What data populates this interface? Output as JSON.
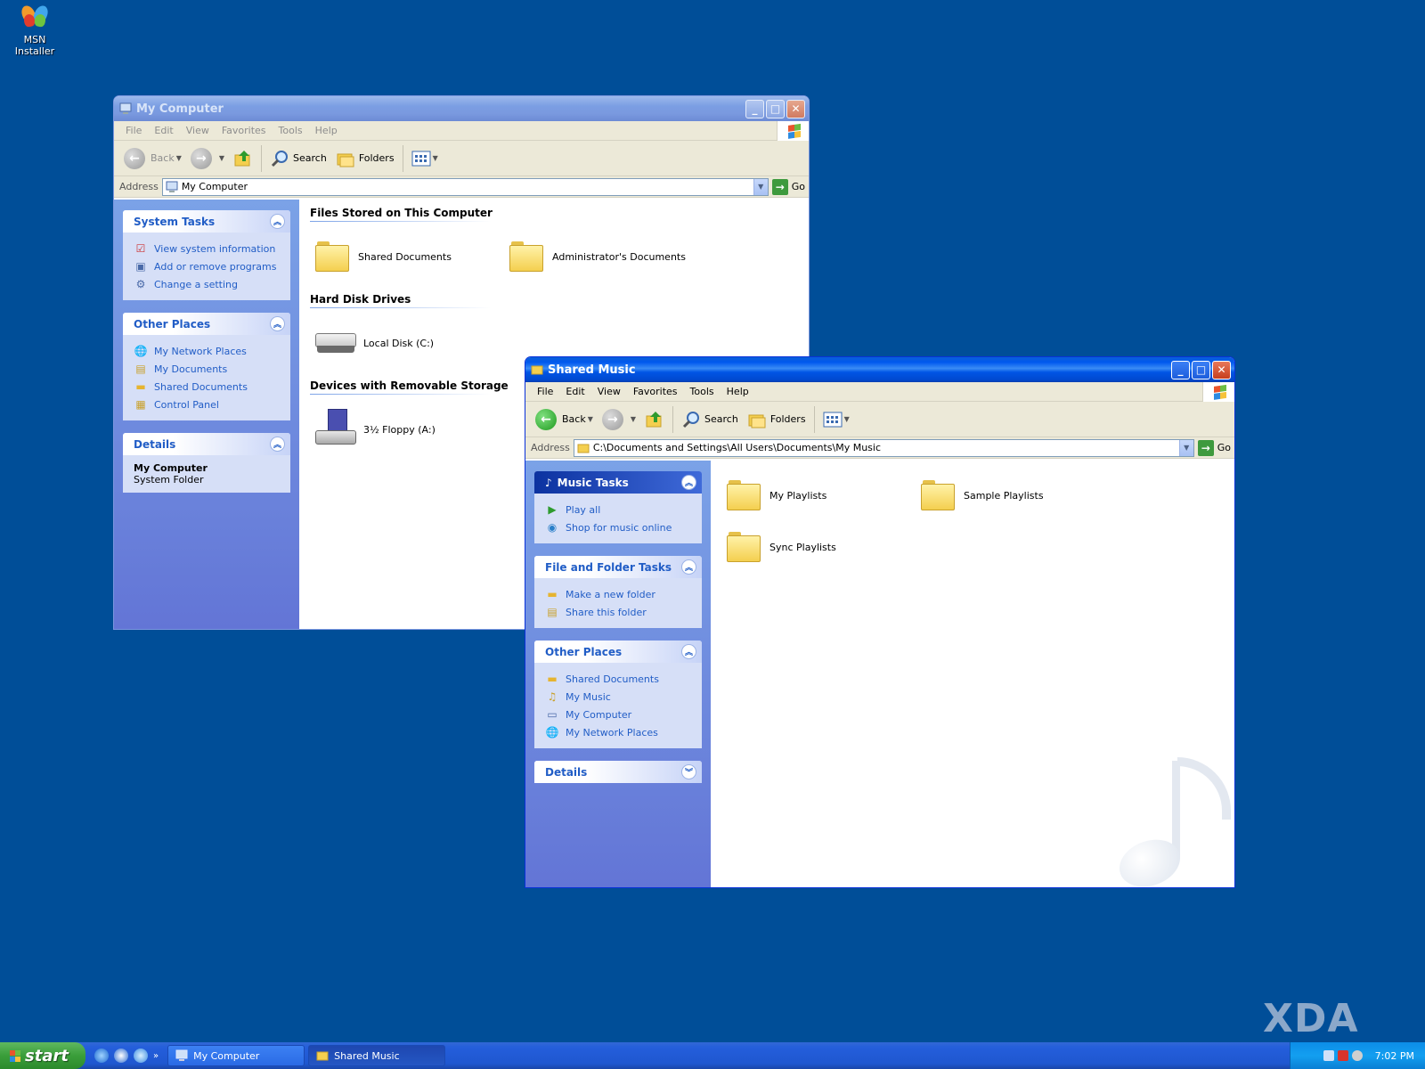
{
  "desktop": {
    "icons": [
      {
        "label": "MSN Installer",
        "icon": "msn-butterfly-icon"
      }
    ],
    "watermark": "XDA"
  },
  "my_computer": {
    "title": "My Computer",
    "menu": [
      "File",
      "Edit",
      "View",
      "Favorites",
      "Tools",
      "Help"
    ],
    "toolbar": {
      "back": "Back",
      "search": "Search",
      "folders": "Folders"
    },
    "address": {
      "label": "Address",
      "value": "My Computer",
      "go": "Go"
    },
    "system_tasks": {
      "title": "System Tasks",
      "links": [
        "View system information",
        "Add or remove programs",
        "Change a setting"
      ]
    },
    "other_places": {
      "title": "Other Places",
      "links": [
        "My Network Places",
        "My Documents",
        "Shared Documents",
        "Control Panel"
      ]
    },
    "details": {
      "title": "Details",
      "name": "My Computer",
      "type": "System Folder"
    },
    "sections": [
      {
        "title": "Files Stored on This Computer",
        "items": [
          "Shared Documents",
          "Administrator's Documents"
        ]
      },
      {
        "title": "Hard Disk Drives",
        "items": [
          "Local Disk (C:)"
        ]
      },
      {
        "title": "Devices with Removable Storage",
        "items": [
          "3½ Floppy (A:)"
        ]
      }
    ]
  },
  "shared_music": {
    "title": "Shared Music",
    "menu": [
      "File",
      "Edit",
      "View",
      "Favorites",
      "Tools",
      "Help"
    ],
    "toolbar": {
      "back": "Back",
      "search": "Search",
      "folders": "Folders"
    },
    "address": {
      "label": "Address",
      "value": "C:\\Documents and Settings\\All Users\\Documents\\My Music",
      "go": "Go"
    },
    "music_tasks": {
      "title": "Music Tasks",
      "links": [
        "Play all",
        "Shop for music online"
      ]
    },
    "file_folder_tasks": {
      "title": "File and Folder Tasks",
      "links": [
        "Make a new folder",
        "Share this folder"
      ]
    },
    "other_places": {
      "title": "Other Places",
      "links": [
        "Shared Documents",
        "My Music",
        "My Computer",
        "My Network Places"
      ]
    },
    "details": {
      "title": "Details"
    },
    "items": [
      "My Playlists",
      "Sample Playlists",
      "Sync Playlists"
    ]
  },
  "taskbar": {
    "start": "start",
    "buttons": [
      "My Computer",
      "Shared Music"
    ],
    "clock": "7:02 PM"
  },
  "colors": {
    "desktop": "#004e98",
    "link": "#215dc6",
    "title_active": "#0058ee",
    "start_green": "#3a9e3a"
  }
}
